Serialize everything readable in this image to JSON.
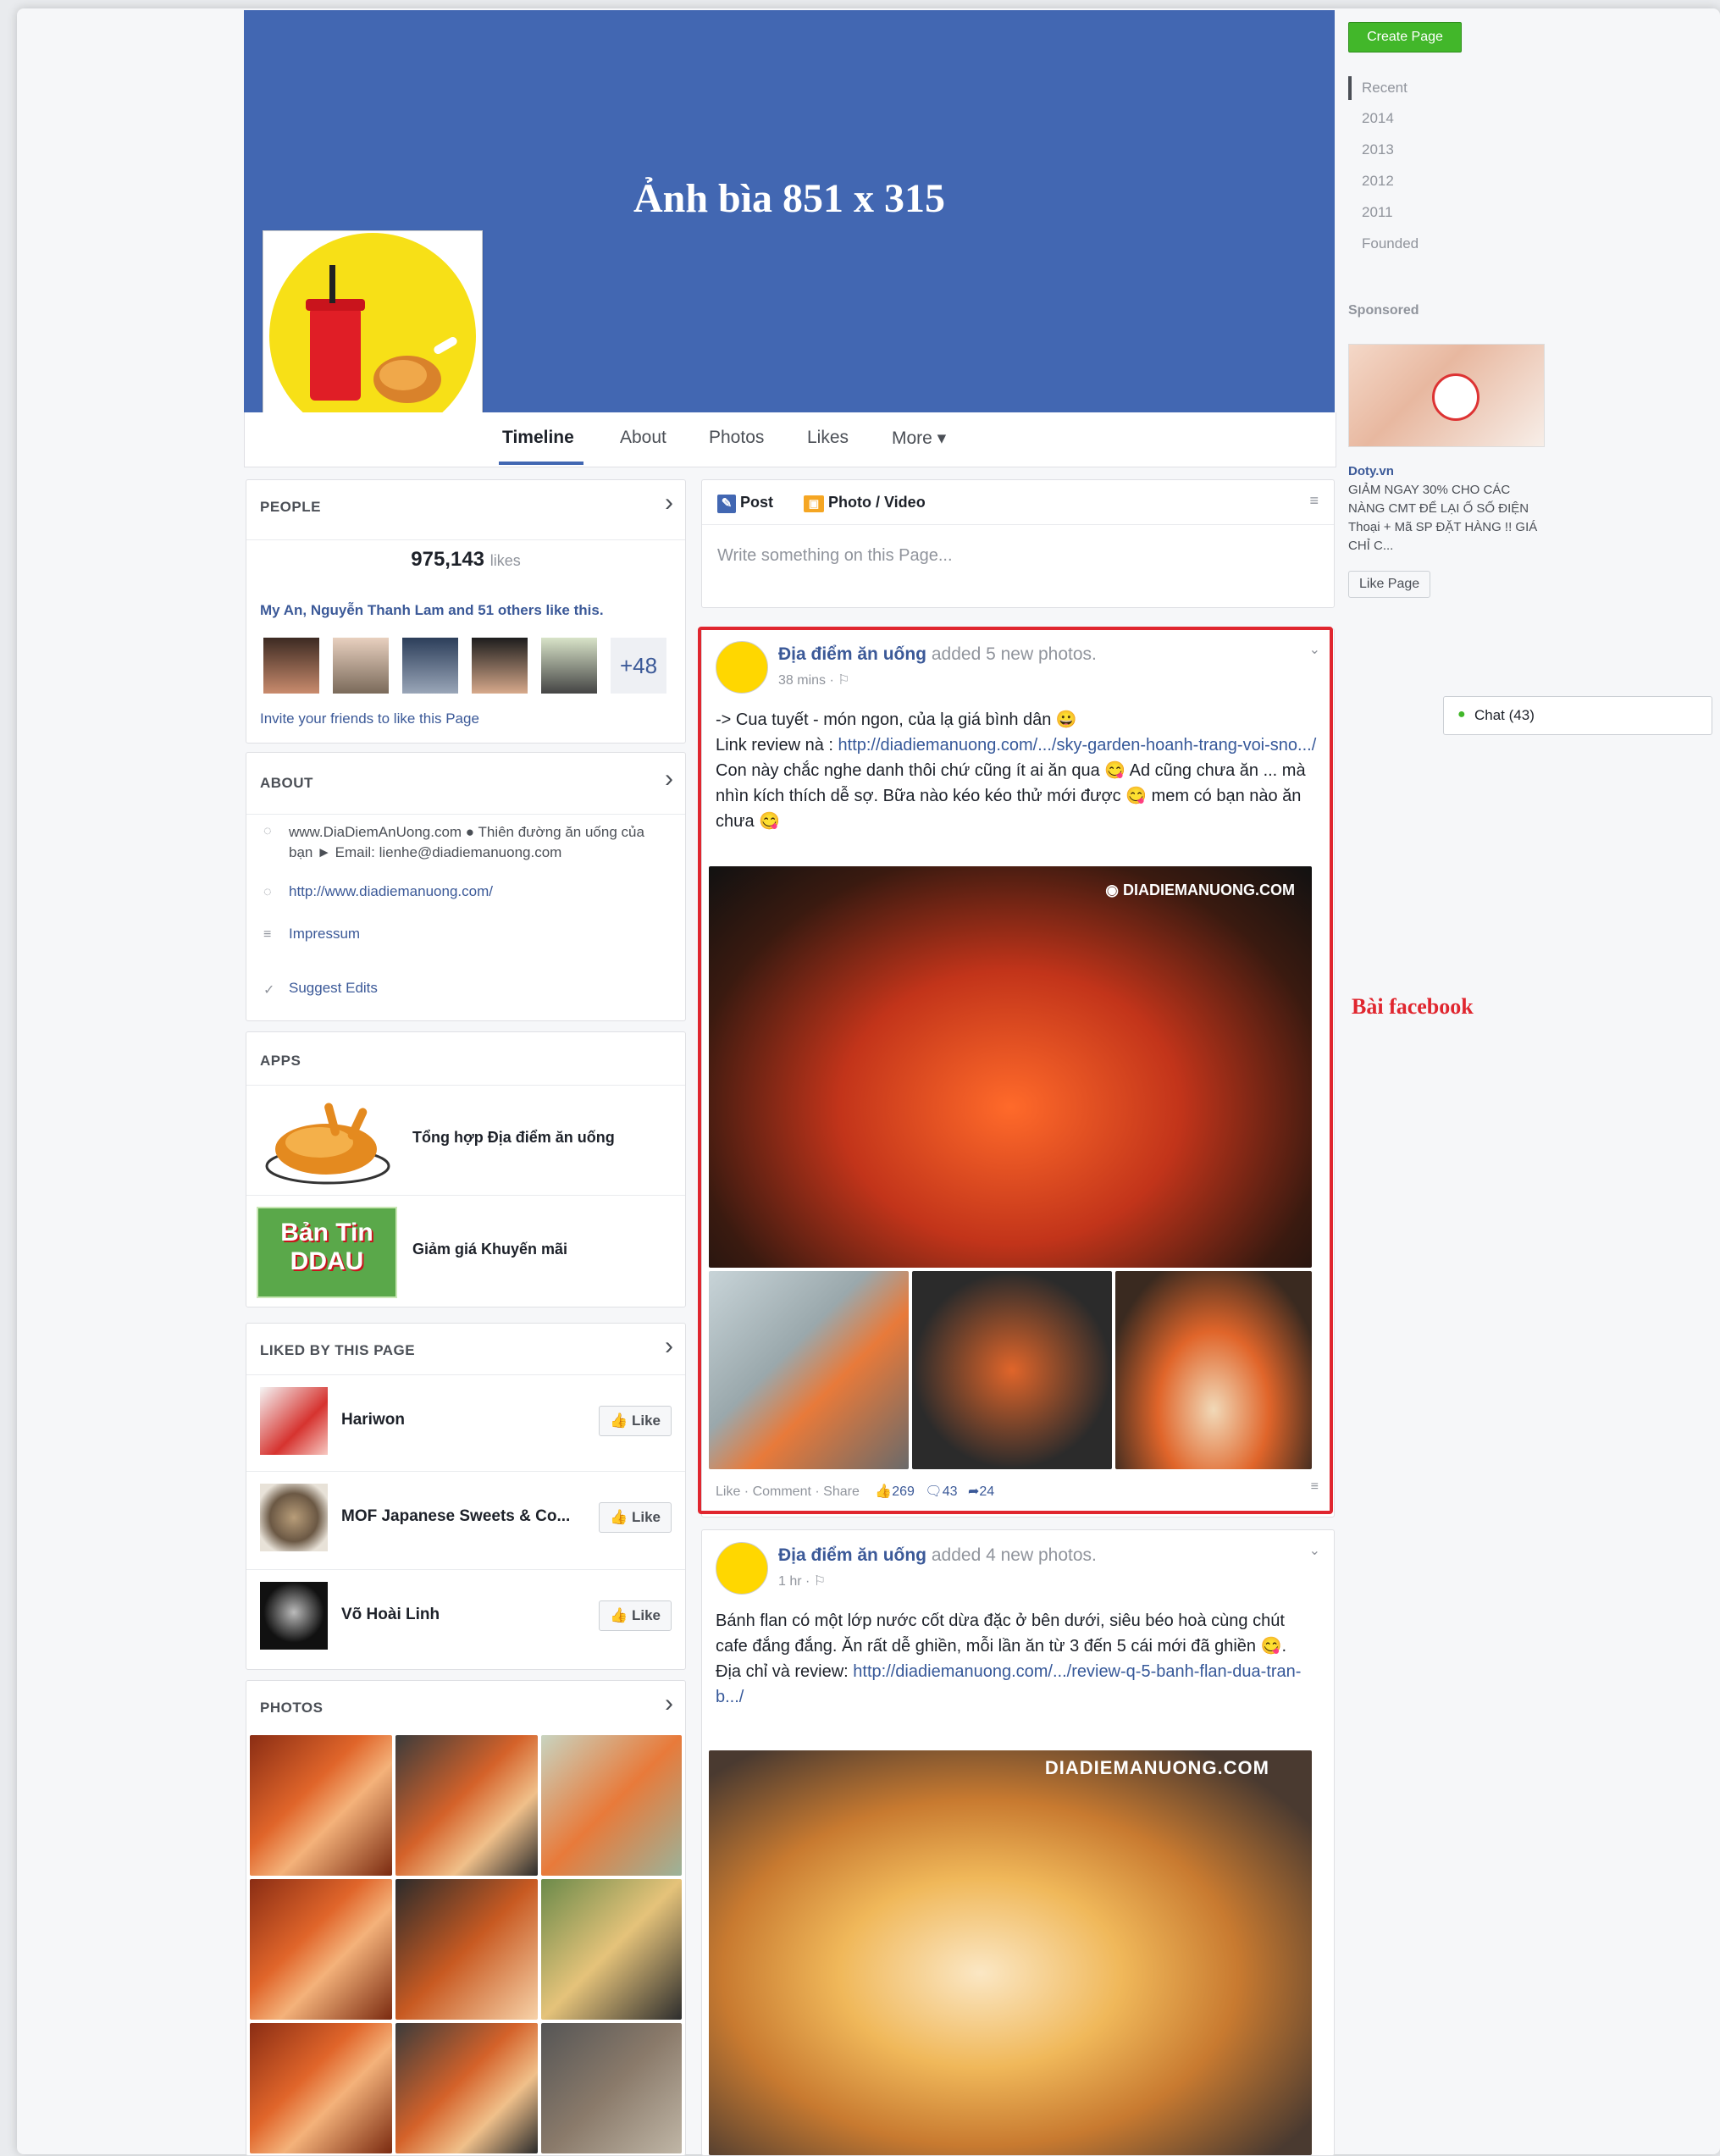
{
  "cover": {
    "title": "Ảnh bìa 851 x 315"
  },
  "tabs": [
    "Timeline",
    "About",
    "Photos",
    "Likes",
    "More ▾"
  ],
  "people": {
    "title": "PEOPLE",
    "count": "975,143",
    "count_suffix": "likes",
    "friends_line": "My An, Nguyễn Thanh Lam and 51 others like this.",
    "more_count": "+48",
    "invite": "Invite your friends to like this Page"
  },
  "about": {
    "title": "ABOUT",
    "line1": "www.DiaDiemAnUong.com ● Thiên đường ăn uống của bạn ► Email: lienhe@diadiemanuong.com",
    "website": "http://www.diadiemanuong.com/",
    "impressum": "Impressum",
    "suggest": "Suggest Edits"
  },
  "apps": {
    "title": "APPS",
    "items": [
      {
        "label": "Tổng hợp Địa điểm ăn uống"
      },
      {
        "label": "Giảm giá Khuyến mãi",
        "badge_line1": "Bản Tin",
        "badge_line2": "DDAU"
      }
    ]
  },
  "liked": {
    "title": "LIKED BY THIS PAGE",
    "items": [
      {
        "name": "Hariwon",
        "button": "Like"
      },
      {
        "name": "MOF Japanese Sweets & Co...",
        "button": "Like"
      },
      {
        "name": "Võ Hoài Linh",
        "button": "Like"
      }
    ]
  },
  "photos": {
    "title": "PHOTOS"
  },
  "composer": {
    "post_tab": "Post",
    "photo_tab": "Photo / Video",
    "placeholder": "Write something on this Page..."
  },
  "post1": {
    "page_name": "Địa điểm ăn uống",
    "action": "added 5 new photos.",
    "time": "38 mins · ⚐",
    "line1": "-> Cua tuyết - món ngon, của lạ giá bình dân 😀",
    "line2_prefix": "Link review nà : ",
    "line2_link": "http://diadiemanuong.com/.../sky-garden-hoanh-trang-voi-sno.../",
    "line3": "Con này chắc nghe danh thôi chứ cũng ít ai ăn qua 😋 Ad cũng chưa ăn ... mà nhìn kích thích dễ sợ. Bữa nào kéo kéo thử mới được 😋 mem có bạn nào ăn chưa 😋",
    "watermark": "DIADIEMANUONG.COM",
    "actions": "Like · Comment · Share",
    "likes": "269",
    "comments": "43",
    "shares": "24"
  },
  "post2": {
    "page_name": "Địa điểm ăn uống",
    "action": "added 4 new photos.",
    "time": "1 hr · ⚐",
    "line1": "Bánh flan có một lớp nước cốt dừa đặc ở bên dưới, siêu béo hoà cùng chút cafe đắng đắng. Ăn rất dễ ghiền, mỗi lần ăn từ 3 đến 5 cái mới đã ghiền 😋.",
    "line2_prefix": "Địa chỉ và review: ",
    "line2_link": "http://diadiemanuong.com/.../review-q-5-banh-flan-dua-tran-b.../",
    "watermark": "DIADIEMANUONG.COM"
  },
  "annotation": {
    "label": "Bài facebook",
    "color": "#e0262f"
  },
  "right": {
    "create_page": "Create Page",
    "years": [
      "Recent",
      "2014",
      "2013",
      "2012",
      "2011",
      "Founded"
    ],
    "sponsored": "Sponsored",
    "ad_brand": "Doty.vn",
    "ad_text": "GIẢM NGAY 30% CHO CÁC NÀNG CMT ĐỂ LẠI Ố SỐ ĐIỆN Thoại + Mã SP ĐẶT HÀNG !! GIÁ CHỈ C...",
    "like_page": "Like Page",
    "chat": "Chat (43)"
  },
  "colors": {
    "brand": "#3b5998",
    "cover": "#4267b2",
    "annotation": "#e0262f",
    "create": "#42b72a"
  }
}
